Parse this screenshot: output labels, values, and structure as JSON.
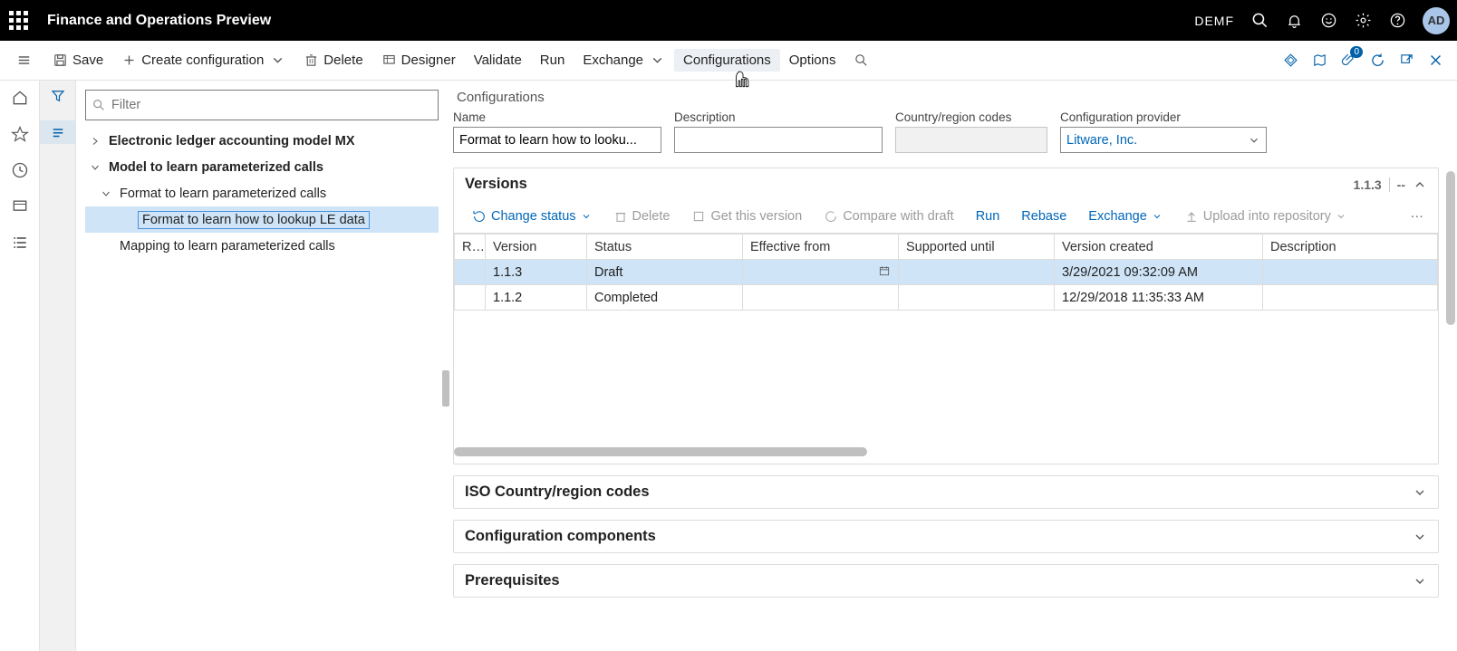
{
  "header": {
    "app_title": "Finance and Operations Preview",
    "company": "DEMF",
    "avatar": "AD"
  },
  "cmdbar": {
    "save": "Save",
    "create": "Create configuration",
    "delete": "Delete",
    "designer": "Designer",
    "validate": "Validate",
    "run": "Run",
    "exchange": "Exchange",
    "configurations": "Configurations",
    "options": "Options"
  },
  "tree": {
    "filter_placeholder": "Filter",
    "n0": "Electronic ledger accounting model MX",
    "n1": "Model to learn parameterized calls",
    "n1a": "Format to learn parameterized calls",
    "n1a1": "Format to learn how to lookup LE data",
    "n1b": "Mapping to learn parameterized calls"
  },
  "page": {
    "title": "Configurations",
    "labels": {
      "name": "Name",
      "description": "Description",
      "ccodes": "Country/region codes",
      "provider": "Configuration provider"
    },
    "values": {
      "name": "Format to learn how to looku...",
      "description": "",
      "ccodes": "",
      "provider": "Litware, Inc."
    }
  },
  "versions": {
    "title": "Versions",
    "current": "1.1.3",
    "dash": "--",
    "toolbar": {
      "change_status": "Change status",
      "delete": "Delete",
      "get_version": "Get this version",
      "compare": "Compare with draft",
      "run": "Run",
      "rebase": "Rebase",
      "exchange": "Exchange",
      "upload": "Upload into repository"
    },
    "columns": {
      "r": "R...",
      "version": "Version",
      "status": "Status",
      "eff_from": "Effective from",
      "supp_until": "Supported until",
      "created": "Version created",
      "desc": "Description"
    },
    "rows": [
      {
        "version": "1.1.3",
        "status": "Draft",
        "eff_from": "",
        "supp_until": "",
        "created": "3/29/2021 09:32:09 AM",
        "desc": ""
      },
      {
        "version": "1.1.2",
        "status": "Completed",
        "eff_from": "",
        "supp_until": "",
        "created": "12/29/2018 11:35:33 AM",
        "desc": ""
      }
    ]
  },
  "sections": {
    "iso": "ISO Country/region codes",
    "components": "Configuration components",
    "prereq": "Prerequisites"
  },
  "right_badge": "0"
}
